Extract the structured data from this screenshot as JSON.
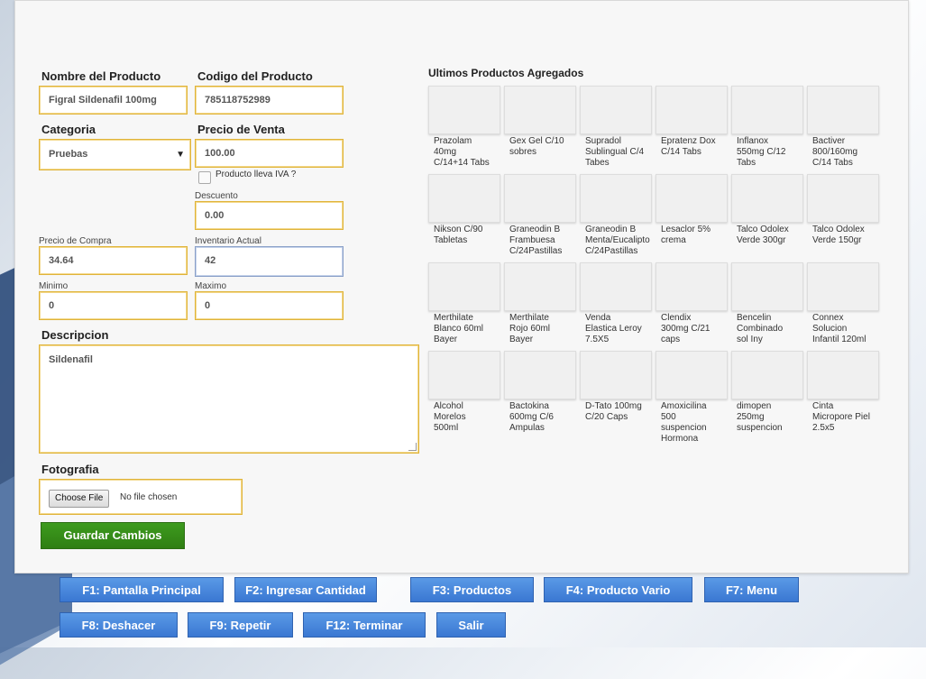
{
  "form": {
    "nombre_label": "Nombre del Producto",
    "nombre_value": "Figral Sildenafil 100mg",
    "codigo_label": "Codigo del Producto",
    "codigo_value": "785118752989",
    "categoria_label": "Categoria",
    "categoria_value": "Pruebas",
    "precio_venta_label": "Precio de Venta",
    "precio_venta_value": "100.00",
    "iva_label": "Producto lleva IVA ?",
    "descuento_label": "Descuento",
    "descuento_value": "0.00",
    "precio_compra_label": "Precio de Compra",
    "precio_compra_value": "34.64",
    "inventario_label": "Inventario Actual",
    "inventario_value": "42",
    "minimo_label": "Minimo",
    "minimo_value": "0",
    "maximo_label": "Maximo",
    "maximo_value": "0",
    "descripcion_label": "Descripcion",
    "descripcion_value": "Sildenafil",
    "fotografia_label": "Fotografia",
    "choose_file_label": "Choose File",
    "no_file_label": "No file chosen",
    "guardar_label": "Guardar Cambios"
  },
  "recent": {
    "title": "Ultimos Productos Agregados",
    "items": [
      [
        "Prazolam",
        "40mg",
        "C/14+14 Tabs"
      ],
      [
        "Gex Gel C/10",
        "sobres"
      ],
      [
        "Supradol",
        "Sublingual C/4",
        "Tabes"
      ],
      [
        "Epratenz Dox",
        "C/14 Tabs"
      ],
      [
        "Inflanox",
        "550mg C/12",
        "Tabs"
      ],
      [
        "Bactiver",
        "800/160mg",
        "C/14 Tabs"
      ],
      [
        "Nikson C/90",
        "Tabletas"
      ],
      [
        "Graneodin B",
        "Frambuesa",
        "C/24Pastillas"
      ],
      [
        "Graneodin B",
        "Menta/Eucalipto",
        "C/24Pastillas"
      ],
      [
        "Lesaclor 5%",
        "crema"
      ],
      [
        "Talco Odolex",
        "Verde 300gr"
      ],
      [
        "Talco Odolex",
        "Verde 150gr"
      ],
      [
        "Merthilate",
        "Blanco 60ml",
        "Bayer"
      ],
      [
        "Merthilate",
        "Rojo 60ml",
        "Bayer"
      ],
      [
        "Venda",
        "Elastica Leroy",
        "7.5X5"
      ],
      [
        "Clendix",
        "300mg C/21",
        "caps"
      ],
      [
        "Bencelin",
        "Combinado",
        "sol Iny"
      ],
      [
        "Connex",
        "Solucion",
        "Infantil 120ml"
      ],
      [
        "Alcohol",
        "Morelos",
        "500ml"
      ],
      [
        "Bactokina",
        "600mg C/6",
        "Ampulas"
      ],
      [
        "D-Tato 100mg",
        "C/20 Caps"
      ],
      [
        "Amoxicilina",
        "500",
        "suspencion",
        "Hormona"
      ],
      [
        "dimopen",
        "250mg",
        "suspencion"
      ],
      [
        "Cinta",
        "Micropore Piel",
        "2.5x5"
      ]
    ]
  },
  "footer": {
    "buttons": [
      "F1: Pantalla Principal",
      "F2: Ingresar Cantidad",
      "F3: Productos",
      "F4: Producto Vario",
      "F7: Menu",
      "F8: Deshacer",
      "F9: Repetir",
      "F12: Terminar",
      "Salir"
    ]
  },
  "colors": {
    "field_border": "#e0b43a",
    "save_button": "#3d9b1e",
    "footer_button": "#4a8be0"
  }
}
